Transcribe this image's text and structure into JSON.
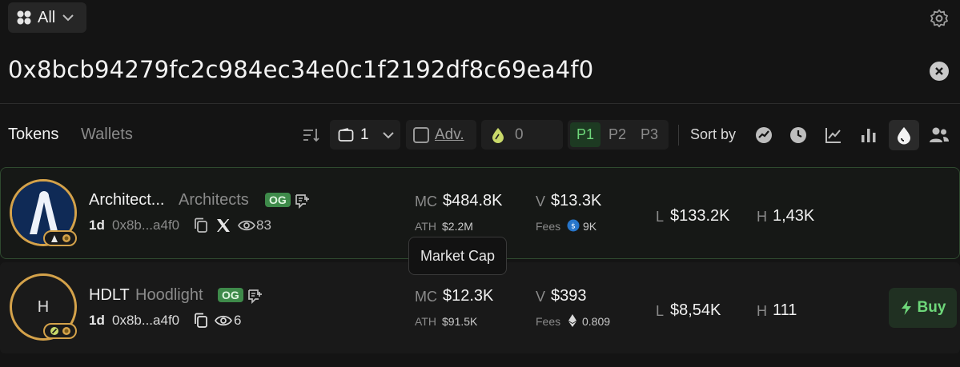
{
  "filter": {
    "label": "All"
  },
  "search": {
    "value": "0x8bcb94279fc2c984ec34e0c1f2192df8c69ea4f0"
  },
  "tabs": {
    "tokens": "Tokens",
    "wallets": "Wallets"
  },
  "toolbar": {
    "wallet_count": "1",
    "adv_label": "Adv.",
    "amount": "0",
    "presets": [
      "P1",
      "P2",
      "P3"
    ],
    "active_preset": "P1",
    "sort_label": "Sort by"
  },
  "tokens": [
    {
      "ticker": "Architect...",
      "name": "Architects",
      "badge": "OG",
      "age": "1d",
      "address": "0x8b...a4f0",
      "views": "83",
      "mc_label": "MC",
      "mc": "$484.8K",
      "ath_label": "ATH",
      "ath": "$2.2M",
      "v_label": "V",
      "volume": "$13.3K",
      "fees_label": "Fees",
      "fees": "9K",
      "l_label": "L",
      "liquidity": "$133.2K",
      "h_label": "H",
      "holders": "1,43K"
    },
    {
      "ticker": "HDLT",
      "name": "Hoodlight",
      "badge": "OG",
      "avatar_letter": "H",
      "age": "1d",
      "address": "0x8b...a4f0",
      "views": "6",
      "mc_label": "MC",
      "mc": "$12.3K",
      "ath_label": "ATH",
      "ath": "$91.5K",
      "v_label": "V",
      "volume": "$393",
      "fees_label": "Fees",
      "fees": "0.809",
      "l_label": "L",
      "liquidity": "$8,54K",
      "h_label": "H",
      "holders": "111",
      "buy_label": "Buy"
    }
  ],
  "tooltip": {
    "text": "Market Cap"
  },
  "colors": {
    "accent": "#6ed77a",
    "avatar_ring": "#d4a24a",
    "og_badge": "#3e8a4a"
  }
}
